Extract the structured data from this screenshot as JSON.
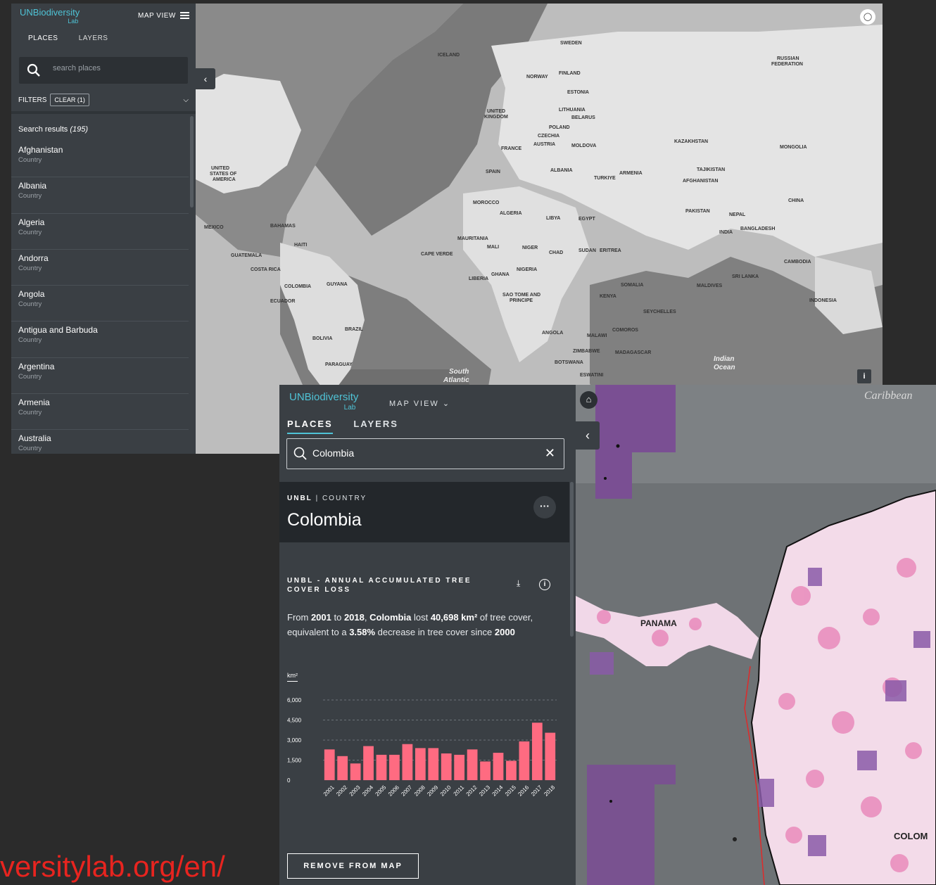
{
  "shot1": {
    "logo": "UNBiodiversity",
    "logo_sub": "Lab",
    "map_view_label": "MAP VIEW",
    "tabs": [
      {
        "label": "PLACES"
      },
      {
        "label": "LAYERS"
      }
    ],
    "search_placeholder": "search places",
    "filters_label": "FILTERS",
    "clear_label": "CLEAR (1)",
    "results_label": "Search results",
    "results_count": "(195)",
    "results": [
      {
        "name": "Afghanistan",
        "type": "Country"
      },
      {
        "name": "Albania",
        "type": "Country"
      },
      {
        "name": "Algeria",
        "type": "Country"
      },
      {
        "name": "Andorra",
        "type": "Country"
      },
      {
        "name": "Angola",
        "type": "Country"
      },
      {
        "name": "Antigua and Barbuda",
        "type": "Country"
      },
      {
        "name": "Argentina",
        "type": "Country"
      },
      {
        "name": "Armenia",
        "type": "Country"
      },
      {
        "name": "Australia",
        "type": "Country"
      }
    ],
    "map_labels": [
      "ICELAND",
      "SWEDEN",
      "NORWAY",
      "FINLAND",
      "ESTONIA",
      "RUSSIAN FEDERATION",
      "UNITED KINGDOM",
      "LITHUANIA",
      "BELARUS",
      "POLAND",
      "FRANCE",
      "CZECHIA",
      "AUSTRIA",
      "MOLDOVA",
      "SPAIN",
      "ALBANIA",
      "TURKIYE",
      "ARMENIA",
      "KAZAKHSTAN",
      "MONGOLIA",
      "TAJIKISTAN",
      "CHINA",
      "AFGHANISTAN",
      "PAKISTAN",
      "NEPAL",
      "INDIA",
      "BANGLADESH",
      "UNITED STATES OF AMERICA",
      "MEXICO",
      "BAHAMAS",
      "HAITI",
      "GUATEMALA",
      "COSTA RICA",
      "COLOMBIA",
      "ECUADOR",
      "GUYANA",
      "BRAZIL",
      "BOLIVIA",
      "PARAGUAY",
      "MOROCCO",
      "ALGERIA",
      "LIBYA",
      "EGYPT",
      "MAURITANIA",
      "MALI",
      "NIGER",
      "CHAD",
      "SUDAN",
      "ERITREA",
      "NIGERIA",
      "GHANA",
      "LIBERIA",
      "ANGOLA",
      "ZIMBABWE",
      "BOTSWANA",
      "ESWATINI",
      "MADAGASCAR",
      "KENYA",
      "SOMALIA",
      "MALDIVES",
      "SRI LANKA",
      "CAMBODIA",
      "INDONESIA",
      "SEYCHELLES",
      "MALAWI",
      "COMOROS",
      "CAPE VERDE",
      "SAO TOME AND PRINCIPE",
      "Indian Ocean",
      "South Atlantic"
    ]
  },
  "shot2": {
    "logo": "UNBiodiversity",
    "logo_sub": "Lab",
    "map_view_label": "MAP VIEW",
    "tabs": [
      {
        "label": "PLACES"
      },
      {
        "label": "LAYERS"
      }
    ],
    "search_value": "Colombia",
    "kind_source": "UNBL",
    "kind_type": "| COUNTRY",
    "place_title": "Colombia",
    "widget_title": "UNBL - ANNUAL ACCUMULATED TREE COVER LOSS",
    "desc": {
      "p1": "From ",
      "y1": "2001",
      "p2": " to ",
      "y2": "2018",
      "p3": ", ",
      "country": "Colombia",
      "p4": " lost ",
      "amount": "40,698 km²",
      "p5": " of tree cover, equivalent to a ",
      "pct": "3.58%",
      "p6": " decrease in tree cover since ",
      "y3": "2000"
    },
    "unit_label": "km²",
    "remove_label": "REMOVE FROM MAP",
    "map_labels": [
      "Caribbean",
      "PANAMA",
      "COLOM"
    ]
  },
  "chart_data": {
    "type": "bar",
    "title": "",
    "xlabel": "",
    "ylabel": "km²",
    "ylim": [
      0,
      6000
    ],
    "yticks": [
      "0",
      "1,500",
      "3,000",
      "4,500",
      "6,000"
    ],
    "categories": [
      "2001",
      "2002",
      "2003",
      "2004",
      "2005",
      "2006",
      "2007",
      "2008",
      "2009",
      "2010",
      "2011",
      "2012",
      "2013",
      "2014",
      "2015",
      "2016",
      "2017",
      "2018"
    ],
    "values": [
      2300,
      1800,
      1250,
      2550,
      1900,
      1900,
      2700,
      2400,
      2400,
      2000,
      1900,
      2300,
      1400,
      2050,
      1450,
      2900,
      4300,
      3550
    ],
    "bar_color": "#ff6b81",
    "grid": true
  },
  "url_text": "versitylab.org/en/",
  "colors": {
    "panel": "#3a3f44",
    "accent": "#4fc3d6",
    "bar": "#ff6b81",
    "url": "#e8241f"
  }
}
